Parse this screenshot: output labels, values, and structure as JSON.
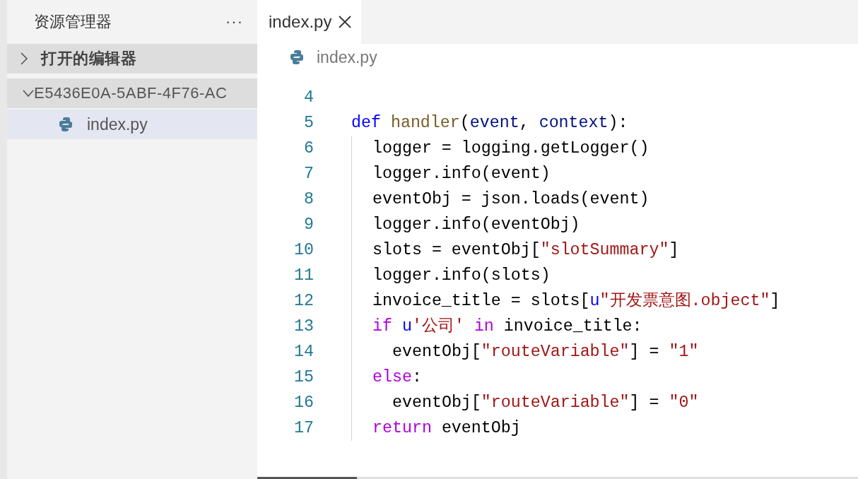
{
  "sidebar": {
    "title": "资源管理器",
    "more": "···",
    "sections": [
      {
        "label": "打开的编辑器",
        "expanded": false
      },
      {
        "label": "E5436E0A-5ABF-4F76-AC",
        "expanded": true,
        "children": [
          {
            "label": "index.py",
            "selected": true
          }
        ]
      }
    ]
  },
  "editor": {
    "tabs": [
      {
        "label": "index.py",
        "selected": true
      }
    ],
    "breadcrumb": "index.py",
    "lines": [
      {
        "number": "4",
        "kind": "top"
      },
      {
        "number": "5",
        "kind": "top",
        "tokens": [
          {
            "kind": "storage",
            "text": "def "
          },
          {
            "kind": "function",
            "text": "handler"
          },
          {
            "kind": "plain",
            "text": "("
          },
          {
            "kind": "param",
            "text": "event"
          },
          {
            "kind": "plain",
            "text": ", "
          },
          {
            "kind": "param",
            "text": "context"
          },
          {
            "kind": "plain",
            "text": "):"
          }
        ]
      },
      {
        "number": "6",
        "kind": "body",
        "tokens": [
          {
            "kind": "plain",
            "text": "logger = logging.getLogger()"
          }
        ]
      },
      {
        "number": "7",
        "kind": "body",
        "tokens": [
          {
            "kind": "plain",
            "text": "logger.info(event)"
          }
        ]
      },
      {
        "number": "8",
        "kind": "body",
        "tokens": [
          {
            "kind": "plain",
            "text": "eventObj = json.loads(event)"
          }
        ]
      },
      {
        "number": "9",
        "kind": "body",
        "tokens": [
          {
            "kind": "plain",
            "text": "logger.info(eventObj)"
          }
        ]
      },
      {
        "number": "10",
        "kind": "body",
        "tokens": [
          {
            "kind": "plain",
            "text": "slots = eventObj["
          },
          {
            "kind": "string",
            "text": "\"slotSummary\""
          },
          {
            "kind": "plain",
            "text": "]"
          }
        ]
      },
      {
        "number": "11",
        "kind": "body",
        "tokens": [
          {
            "kind": "plain",
            "text": "logger.info(slots)"
          }
        ]
      },
      {
        "number": "12",
        "kind": "body",
        "tokens": [
          {
            "kind": "plain",
            "text": "invoice_title = slots["
          },
          {
            "kind": "storage",
            "text": "u"
          },
          {
            "kind": "string",
            "text": "\"开发票意图.object\""
          },
          {
            "kind": "plain",
            "text": "]"
          }
        ]
      },
      {
        "number": "13",
        "kind": "body",
        "tokens": [
          {
            "kind": "keyword",
            "text": "if "
          },
          {
            "kind": "storage",
            "text": "u"
          },
          {
            "kind": "string",
            "text": "'公司' "
          },
          {
            "kind": "keyword",
            "text": "in "
          },
          {
            "kind": "plain",
            "text": "invoice_title:"
          }
        ]
      },
      {
        "number": "14",
        "kind": "nested",
        "tokens": [
          {
            "kind": "plain",
            "text": "eventObj["
          },
          {
            "kind": "string",
            "text": "\"routeVariable\""
          },
          {
            "kind": "plain",
            "text": "] = "
          },
          {
            "kind": "string",
            "text": "\"1\""
          }
        ]
      },
      {
        "number": "15",
        "kind": "body",
        "tokens": [
          {
            "kind": "keyword",
            "text": "else"
          },
          {
            "kind": "plain",
            "text": ":"
          }
        ]
      },
      {
        "number": "16",
        "kind": "nested",
        "tokens": [
          {
            "kind": "plain",
            "text": "eventObj["
          },
          {
            "kind": "string",
            "text": "\"routeVariable\""
          },
          {
            "kind": "plain",
            "text": "] = "
          },
          {
            "kind": "string",
            "text": "\"0\""
          }
        ]
      },
      {
        "number": "17",
        "kind": "body",
        "tokens": [
          {
            "kind": "keyword",
            "text": "return "
          },
          {
            "kind": "plain",
            "text": "eventObj"
          }
        ]
      }
    ]
  }
}
